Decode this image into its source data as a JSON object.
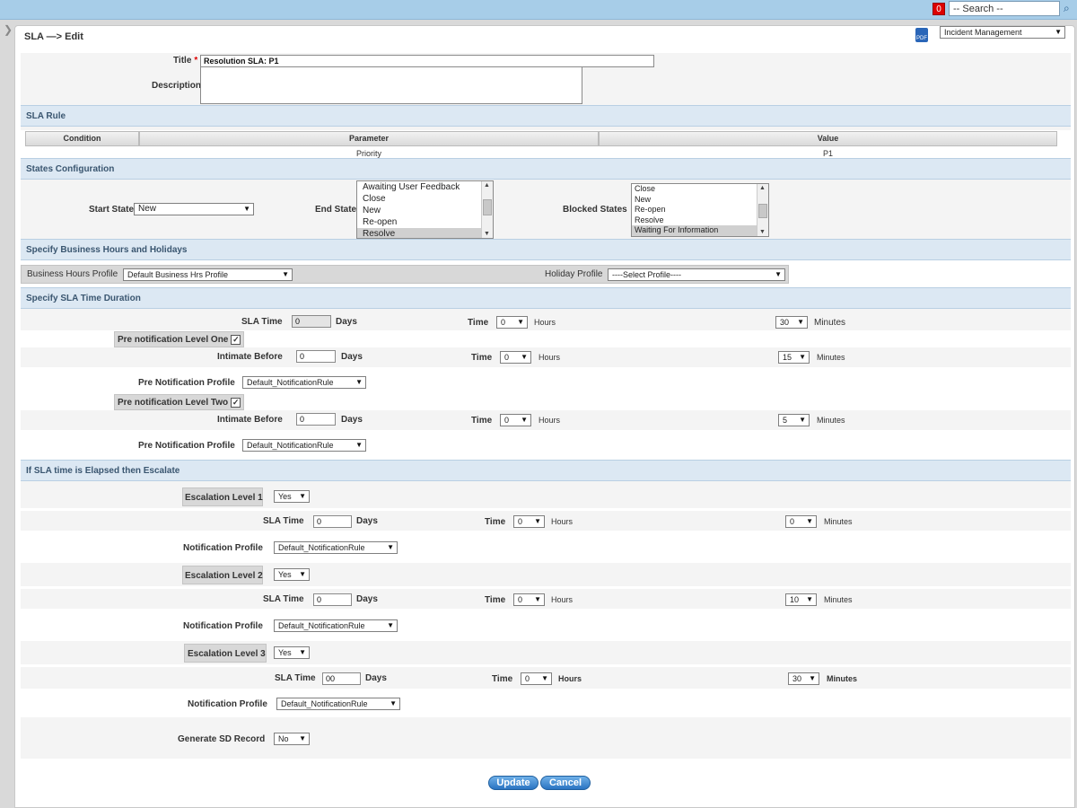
{
  "topbar": {
    "notification_count": "0",
    "search_value": "-- Search --"
  },
  "page": {
    "title": "SLA —> Edit",
    "module_select": "Incident Management"
  },
  "form": {
    "title_label": "Title",
    "required_mark": "*",
    "title_value": "Resolution SLA: P1",
    "description_label": "Description"
  },
  "sla_rule": {
    "header": "SLA Rule",
    "columns": [
      "Condition",
      "Parameter",
      "Value"
    ],
    "row": {
      "condition": "",
      "parameter": "Priority",
      "value": "P1"
    }
  },
  "states": {
    "header": "States Configuration",
    "start_label": "Start State",
    "start_value": "New",
    "end_label": "End State",
    "end_options": [
      "Awaiting User Feedback",
      "Close",
      "New",
      "Re-open",
      "Resolve"
    ],
    "end_selected": "Resolve",
    "blocked_label": "Blocked States",
    "blocked_options": [
      "Close",
      "New",
      "Re-open",
      "Resolve",
      "Waiting For Information"
    ],
    "blocked_selected": "Waiting For Information"
  },
  "business_hours": {
    "header": "Specify Business Hours and Holidays",
    "profile_label": "Business Hours Profile",
    "profile_value": "Default Business Hrs Profile",
    "holiday_label": "Holiday Profile",
    "holiday_value": "----Select Profile----"
  },
  "duration": {
    "header": "Specify SLA Time Duration",
    "sla_time_label": "SLA Time",
    "days_value": "0",
    "days_label": "Days",
    "time_label": "Time",
    "hours_value": "0",
    "hours_label": "Hours",
    "minutes_value": "30",
    "minutes_label": "Minutes",
    "pre1": {
      "label": "Pre notification Level One",
      "checked": "✓",
      "intimate_label": "Intimate Before",
      "days_value": "0",
      "days_label": "Days",
      "time_label": "Time",
      "hours_value": "0",
      "hours_label": "Hours",
      "minutes_value": "15",
      "minutes_label": "Minutes",
      "profile_label": "Pre Notification Profile",
      "profile_value": "Default_NotificationRule"
    },
    "pre2": {
      "label": "Pre notification Level Two",
      "checked": "✓",
      "intimate_label": "Intimate Before",
      "days_value": "0",
      "days_label": "Days",
      "time_label": "Time",
      "hours_value": "0",
      "hours_label": "Hours",
      "minutes_value": "5",
      "minutes_label": "Minutes",
      "profile_label": "Pre Notification Profile",
      "profile_value": "Default_NotificationRule"
    }
  },
  "escalate": {
    "header": "If SLA time is Elapsed then Escalate",
    "levels": [
      {
        "label": "Escalation Level 1",
        "enabled": "Yes",
        "sla_time_label": "SLA Time",
        "days_value": "0",
        "days_label": "Days",
        "time_label": "Time",
        "hours_value": "0",
        "hours_label": "Hours",
        "minutes_value": "0",
        "minutes_label": "Minutes",
        "profile_label": "Notification Profile",
        "profile_value": "Default_NotificationRule"
      },
      {
        "label": "Escalation Level 2",
        "enabled": "Yes",
        "sla_time_label": "SLA Time",
        "days_value": "0",
        "days_label": "Days",
        "time_label": "Time",
        "hours_value": "0",
        "hours_label": "Hours",
        "minutes_value": "10",
        "minutes_label": "Minutes",
        "profile_label": "Notification Profile",
        "profile_value": "Default_NotificationRule"
      },
      {
        "label": "Escalation Level 3",
        "enabled": "Yes",
        "sla_time_label": "SLA Time",
        "days_value": "00",
        "days_label": "Days",
        "time_label": "Time",
        "hours_value": "0",
        "hours_label": "Hours",
        "minutes_value": "30",
        "minutes_label": "Minutes",
        "profile_label": "Notification Profile",
        "profile_value": "Default_NotificationRule"
      }
    ],
    "generate_label": "Generate SD Record",
    "generate_value": "No"
  },
  "actions": {
    "update_label": "Update",
    "cancel_label": "Cancel"
  },
  "icons": {
    "dropdown": "▼",
    "up": "▲",
    "side": "›",
    "search": "🔍"
  }
}
